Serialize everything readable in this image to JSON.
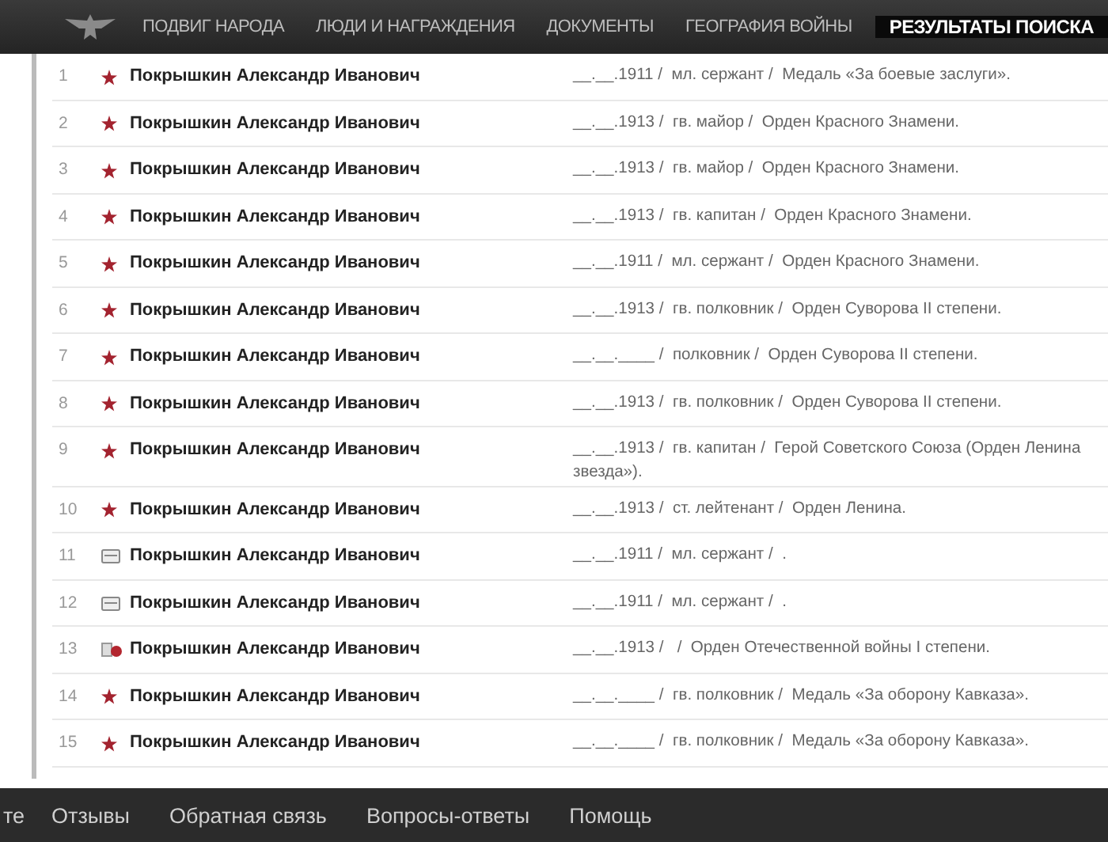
{
  "nav": {
    "items": [
      {
        "label": "ПОДВИГ НАРОДА",
        "selected": false
      },
      {
        "label": "ЛЮДИ И НАГРАЖДЕНИЯ",
        "selected": false
      },
      {
        "label": "ДОКУМЕНТЫ",
        "selected": false
      },
      {
        "label": "ГЕОГРАФИЯ ВОЙНЫ",
        "selected": false
      },
      {
        "label": "РЕЗУЛЬТАТЫ ПОИСКА",
        "selected": true
      }
    ]
  },
  "results": [
    {
      "number": "1",
      "kind": "star",
      "name": "Покрышкин Александр Иванович",
      "details": "__.__.1911 /  мл. сержант /  Медаль «За боевые заслуги»."
    },
    {
      "number": "2",
      "kind": "star",
      "name": "Покрышкин Александр Иванович",
      "details": "__.__.1913 /  гв. майор /  Орден Красного Знамени."
    },
    {
      "number": "3",
      "kind": "star",
      "name": "Покрышкин Александр Иванович",
      "details": "__.__.1913 /  гв. майор /  Орден Красного Знамени."
    },
    {
      "number": "4",
      "kind": "star",
      "name": "Покрышкин Александр Иванович",
      "details": "__.__.1913 /  гв. капитан /  Орден Красного Знамени."
    },
    {
      "number": "5",
      "kind": "star",
      "name": "Покрышкин Александр Иванович",
      "details": "__.__.1911 /  мл. сержант /  Орден Красного Знамени."
    },
    {
      "number": "6",
      "kind": "star",
      "name": "Покрышкин Александр Иванович",
      "details": "__.__.1913 /  гв. полковник /  Орден Суворова II степени."
    },
    {
      "number": "7",
      "kind": "star",
      "name": "Покрышкин Александр Иванович",
      "details": "__.__.____ /  полковник /  Орден Суворова II степени."
    },
    {
      "number": "8",
      "kind": "star",
      "name": "Покрышкин Александр Иванович",
      "details": "__.__.1913 /  гв. полковник /  Орден Суворова II степени."
    },
    {
      "number": "9",
      "kind": "star",
      "name": "Покрышкин Александр Иванович",
      "details": "__.__.1913 /  гв. капитан /  Герой Советского Союза (Орден Ленина\nзвезда»)."
    },
    {
      "number": "10",
      "kind": "star",
      "name": "Покрышкин Александр Иванович",
      "details": "__.__.1913 /  ст. лейтенант /  Орден Ленина."
    },
    {
      "number": "11",
      "kind": "document",
      "name": "Покрышкин Александр Иванович",
      "details": "__.__.1911 /  мл. сержант /  ."
    },
    {
      "number": "12",
      "kind": "document",
      "name": "Покрышкин Александр Иванович",
      "details": "__.__.1911 /  мл. сержант /  ."
    },
    {
      "number": "13",
      "kind": "order",
      "name": "Покрышкин Александр Иванович",
      "details": "__.__.1913 /   /  Орден Отечественной войны I степени."
    },
    {
      "number": "14",
      "kind": "star",
      "name": "Покрышкин Александр Иванович",
      "details": "__.__.____ /  гв. полковник /  Медаль «За оборону Кавказа»."
    },
    {
      "number": "15",
      "kind": "star",
      "name": "Покрышкин Александр Иванович",
      "details": "__.__.____ /  гв. полковник /  Медаль «За оборону Кавказа»."
    }
  ],
  "footer": {
    "links": [
      "те",
      "Отзывы",
      "Обратная связь",
      "Вопросы-ответы",
      "Помощь"
    ]
  }
}
